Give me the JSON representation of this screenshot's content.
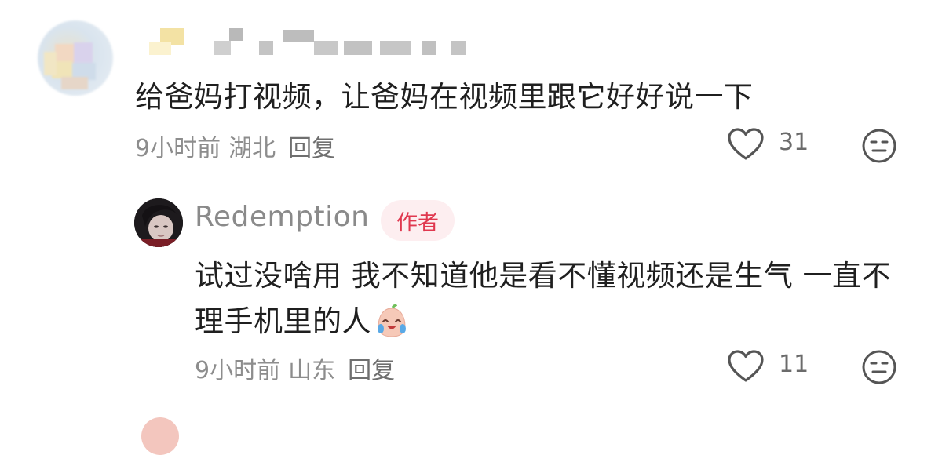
{
  "comment": {
    "text": "给爸妈打视频，让爸妈在视频里跟它好好说一下",
    "time": "9小时前",
    "location": "湖北",
    "reply_label": "回复",
    "likes": "31",
    "avatar_icon": "blurred-avatar",
    "like_icon": "heart-outline-icon",
    "reaction_icon": "neutral-face-icon"
  },
  "reply": {
    "username": "Redemption",
    "badge": "作者",
    "text": "试过没啥用 我不知道他是看不懂视频还是生气 一直不理手机里的人",
    "emoji": "crying-laughing-emoji",
    "time": "9小时前",
    "location": "山东",
    "reply_label": "回复",
    "likes": "11",
    "like_icon": "heart-outline-icon",
    "reaction_icon": "neutral-face-icon"
  },
  "colors": {
    "badge_text": "#e0384f",
    "badge_bg": "#fdeef0",
    "meta_text": "#8d8d8d"
  }
}
